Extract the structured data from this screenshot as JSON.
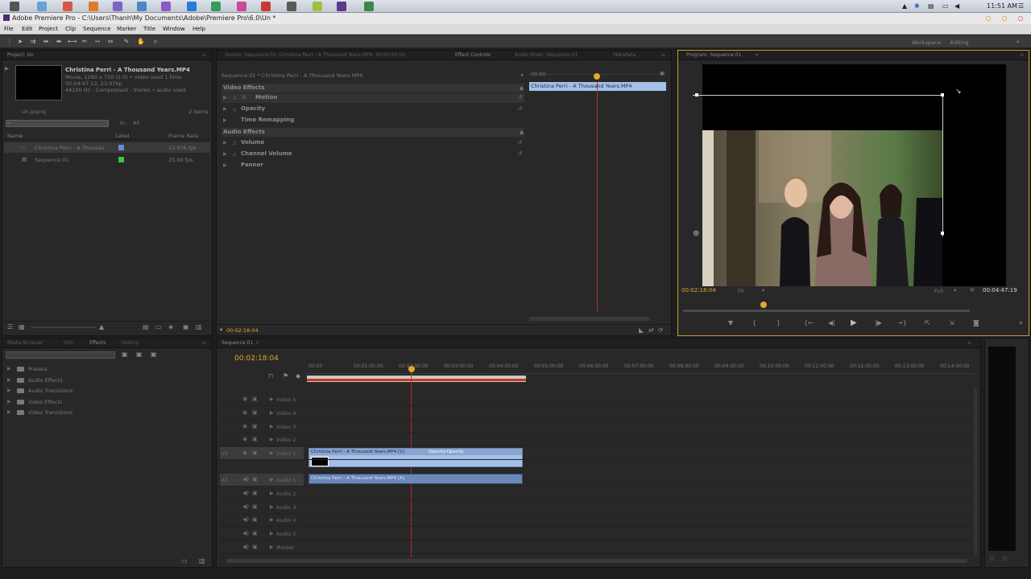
{
  "taskbar": {
    "icons": [
      {
        "name": "apple-icon",
        "color": "#555"
      },
      {
        "name": "finder-icon",
        "color": "#6aa0d8"
      },
      {
        "name": "chrome-icon",
        "color": "#d8554a"
      },
      {
        "name": "firefox-icon",
        "color": "#e07a2c"
      },
      {
        "name": "itunes-icon",
        "color": "#7a66c8"
      },
      {
        "name": "app-icon",
        "color": "#4a86c8"
      },
      {
        "name": "app-icon",
        "color": "#8a5ac8"
      },
      {
        "name": "app-icon",
        "color": "#2a7ad8"
      },
      {
        "name": "app-icon",
        "color": "#3a9a5a"
      },
      {
        "name": "app-icon",
        "color": "#c84a9a"
      },
      {
        "name": "app-icon",
        "color": "#c83a3a"
      },
      {
        "name": "app-icon",
        "color": "#5a5a5a"
      },
      {
        "name": "app-icon",
        "color": "#a0c040"
      },
      {
        "name": "premiere-icon",
        "color": "#5a3a8a"
      },
      {
        "name": "app-icon",
        "color": "#3a8a4a"
      }
    ],
    "clock": "11:51 AM"
  },
  "window": {
    "title": "Adobe Premiere Pro - C:\\Users\\Thanh\\My Documents\\Adobe\\Premiere Pro\\6.0\\Un *"
  },
  "menu": [
    "File",
    "Edit",
    "Project",
    "Clip",
    "Sequence",
    "Marker",
    "Title",
    "Window",
    "Help"
  ],
  "workspace": {
    "label": "Workspace:",
    "value": "Editing"
  },
  "project": {
    "tab": "Project: Un",
    "clip_name": "Christina Perri - A Thousand Years.MP4",
    "clip_info1": "Movie, 1280 x 720 (1.0)  •  video used 1 time",
    "clip_info2": "00:04:47:12, 23.976p",
    "clip_info3": "44100 Hz - Compressed - Stereo  •  audio used",
    "project_file": "Un.prproj",
    "item_count": "2 Items",
    "search_placeholder": "",
    "in_label": "In:",
    "in_value": "All",
    "columns": [
      "Name",
      "Label",
      "Frame Rate"
    ],
    "items": [
      {
        "name": "Christina Perri - A Thousan",
        "rate": "23.976 fps",
        "label_color": "#6a8ad8"
      },
      {
        "name": "Sequence 01",
        "rate": "25.00 fps",
        "label_color": "#3ac83a"
      }
    ]
  },
  "effect_controls": {
    "tabs": [
      "Source: Sequence 01: Christina Perri - A Thousand Years.MP4: 00:00:00:00",
      "Effect Controls",
      "Audio Mixer: Sequence 01",
      "Metadata"
    ],
    "header": "Sequence 01 * Christina Perri - A Thousand Years.MP4",
    "ruler_time": "00:00",
    "clip_bar": "Christina Perri - A Thousand Years.MP4",
    "video_effects_label": "Video Effects",
    "video_effects": [
      "Motion",
      "Opacity",
      "Time Remapping"
    ],
    "audio_effects_label": "Audio Effects",
    "audio_effects": [
      "Volume",
      "Channel Volume",
      "Panner"
    ],
    "timecode": "00:02:18:04"
  },
  "program_monitor": {
    "tab": "Program: Sequence 01",
    "current_time": "00:02:18:04",
    "fit": "Fit",
    "duration": "00:04:47:19",
    "full": "Full",
    "playhead_fraction": 0.27
  },
  "media_panel": {
    "tabs": [
      "Media Browser",
      "Info",
      "Effects",
      "History"
    ],
    "items": [
      "Presets",
      "Audio Effects",
      "Audio Transitions",
      "Video Effects",
      "Video Transitions"
    ]
  },
  "timeline": {
    "tab": "Sequence 01",
    "timecode": "00:02:18:04",
    "ruler": [
      "00:00",
      "00:01:00:00",
      "00:02:00:00",
      "00:03:00:00",
      "00:04:00:00",
      "00:05:00:00",
      "00:06:00:00",
      "00:07:00:00",
      "00:08:00:00",
      "00:09:00:00",
      "00:10:00:00",
      "00:11:00:00",
      "00:12:00:00",
      "00:13:00:00",
      "00:14:00:00"
    ],
    "video_tracks": [
      "Video 5",
      "Video 4",
      "Video 3",
      "Video 2",
      "Video 1"
    ],
    "audio_tracks": [
      "Audio 1",
      "Audio 2",
      "Audio 3",
      "Audio 4",
      "Audio 5",
      "Master"
    ],
    "v1_label": "V1",
    "a1_label": "A1",
    "video_clip": "Christina Perri - A Thousand Years.MP4 [V]",
    "video_clip_fx": "Opacity:Opacity",
    "audio_clip": "Christina Perri - A Thousand Years.MP4 [A]"
  }
}
